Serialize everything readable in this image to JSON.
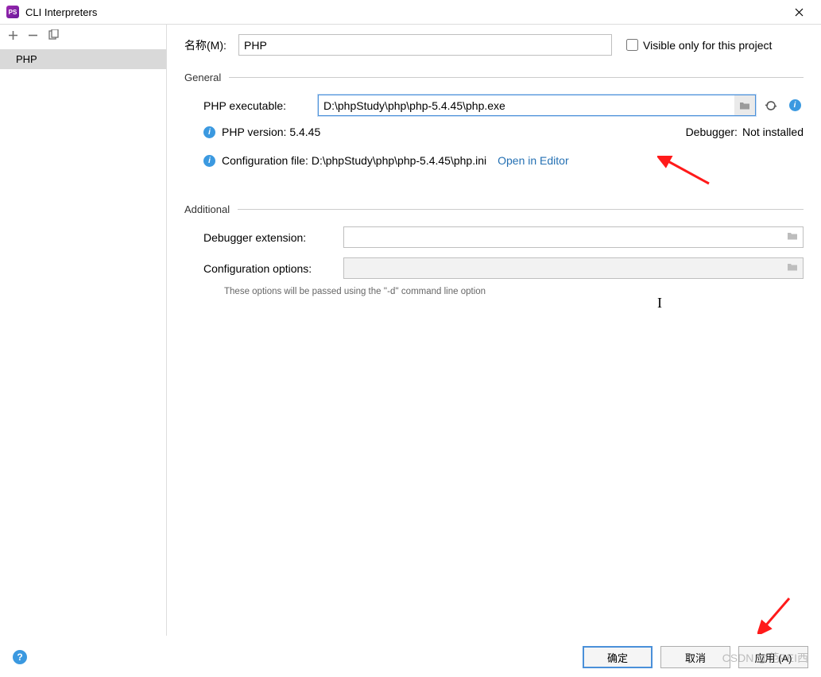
{
  "titlebar": {
    "appIconText": "PS",
    "title": "CLI Interpreters"
  },
  "sidebar": {
    "items": [
      {
        "label": "PHP",
        "selected": true
      }
    ]
  },
  "name": {
    "label": "名称(M):",
    "value": "PHP"
  },
  "visibleOnly": {
    "label": "Visible only for this project",
    "checked": false
  },
  "sections": {
    "general": "General",
    "additional": "Additional"
  },
  "general": {
    "executableLabel": "PHP executable:",
    "executableValue": "D:\\phpStudy\\php\\php-5.4.45\\php.exe",
    "phpVersionLabel": "PHP version: 5.4.45",
    "debuggerLabel": "Debugger:",
    "debuggerValue": "Not installed",
    "configFileLabel": "Configuration file: D:\\phpStudy\\php\\php-5.4.45\\php.ini",
    "openInEditor": "Open in Editor"
  },
  "additional": {
    "debuggerExtLabel": "Debugger extension:",
    "debuggerExtValue": "",
    "configOptionsLabel": "Configuration options:",
    "configOptionsValue": "",
    "hint": "These options will be passed using the ''-d'' command line option"
  },
  "footer": {
    "ok": "确定",
    "cancel": "取消",
    "apply": "应用 (A)"
  },
  "watermark": "CSDN @范PEI西"
}
